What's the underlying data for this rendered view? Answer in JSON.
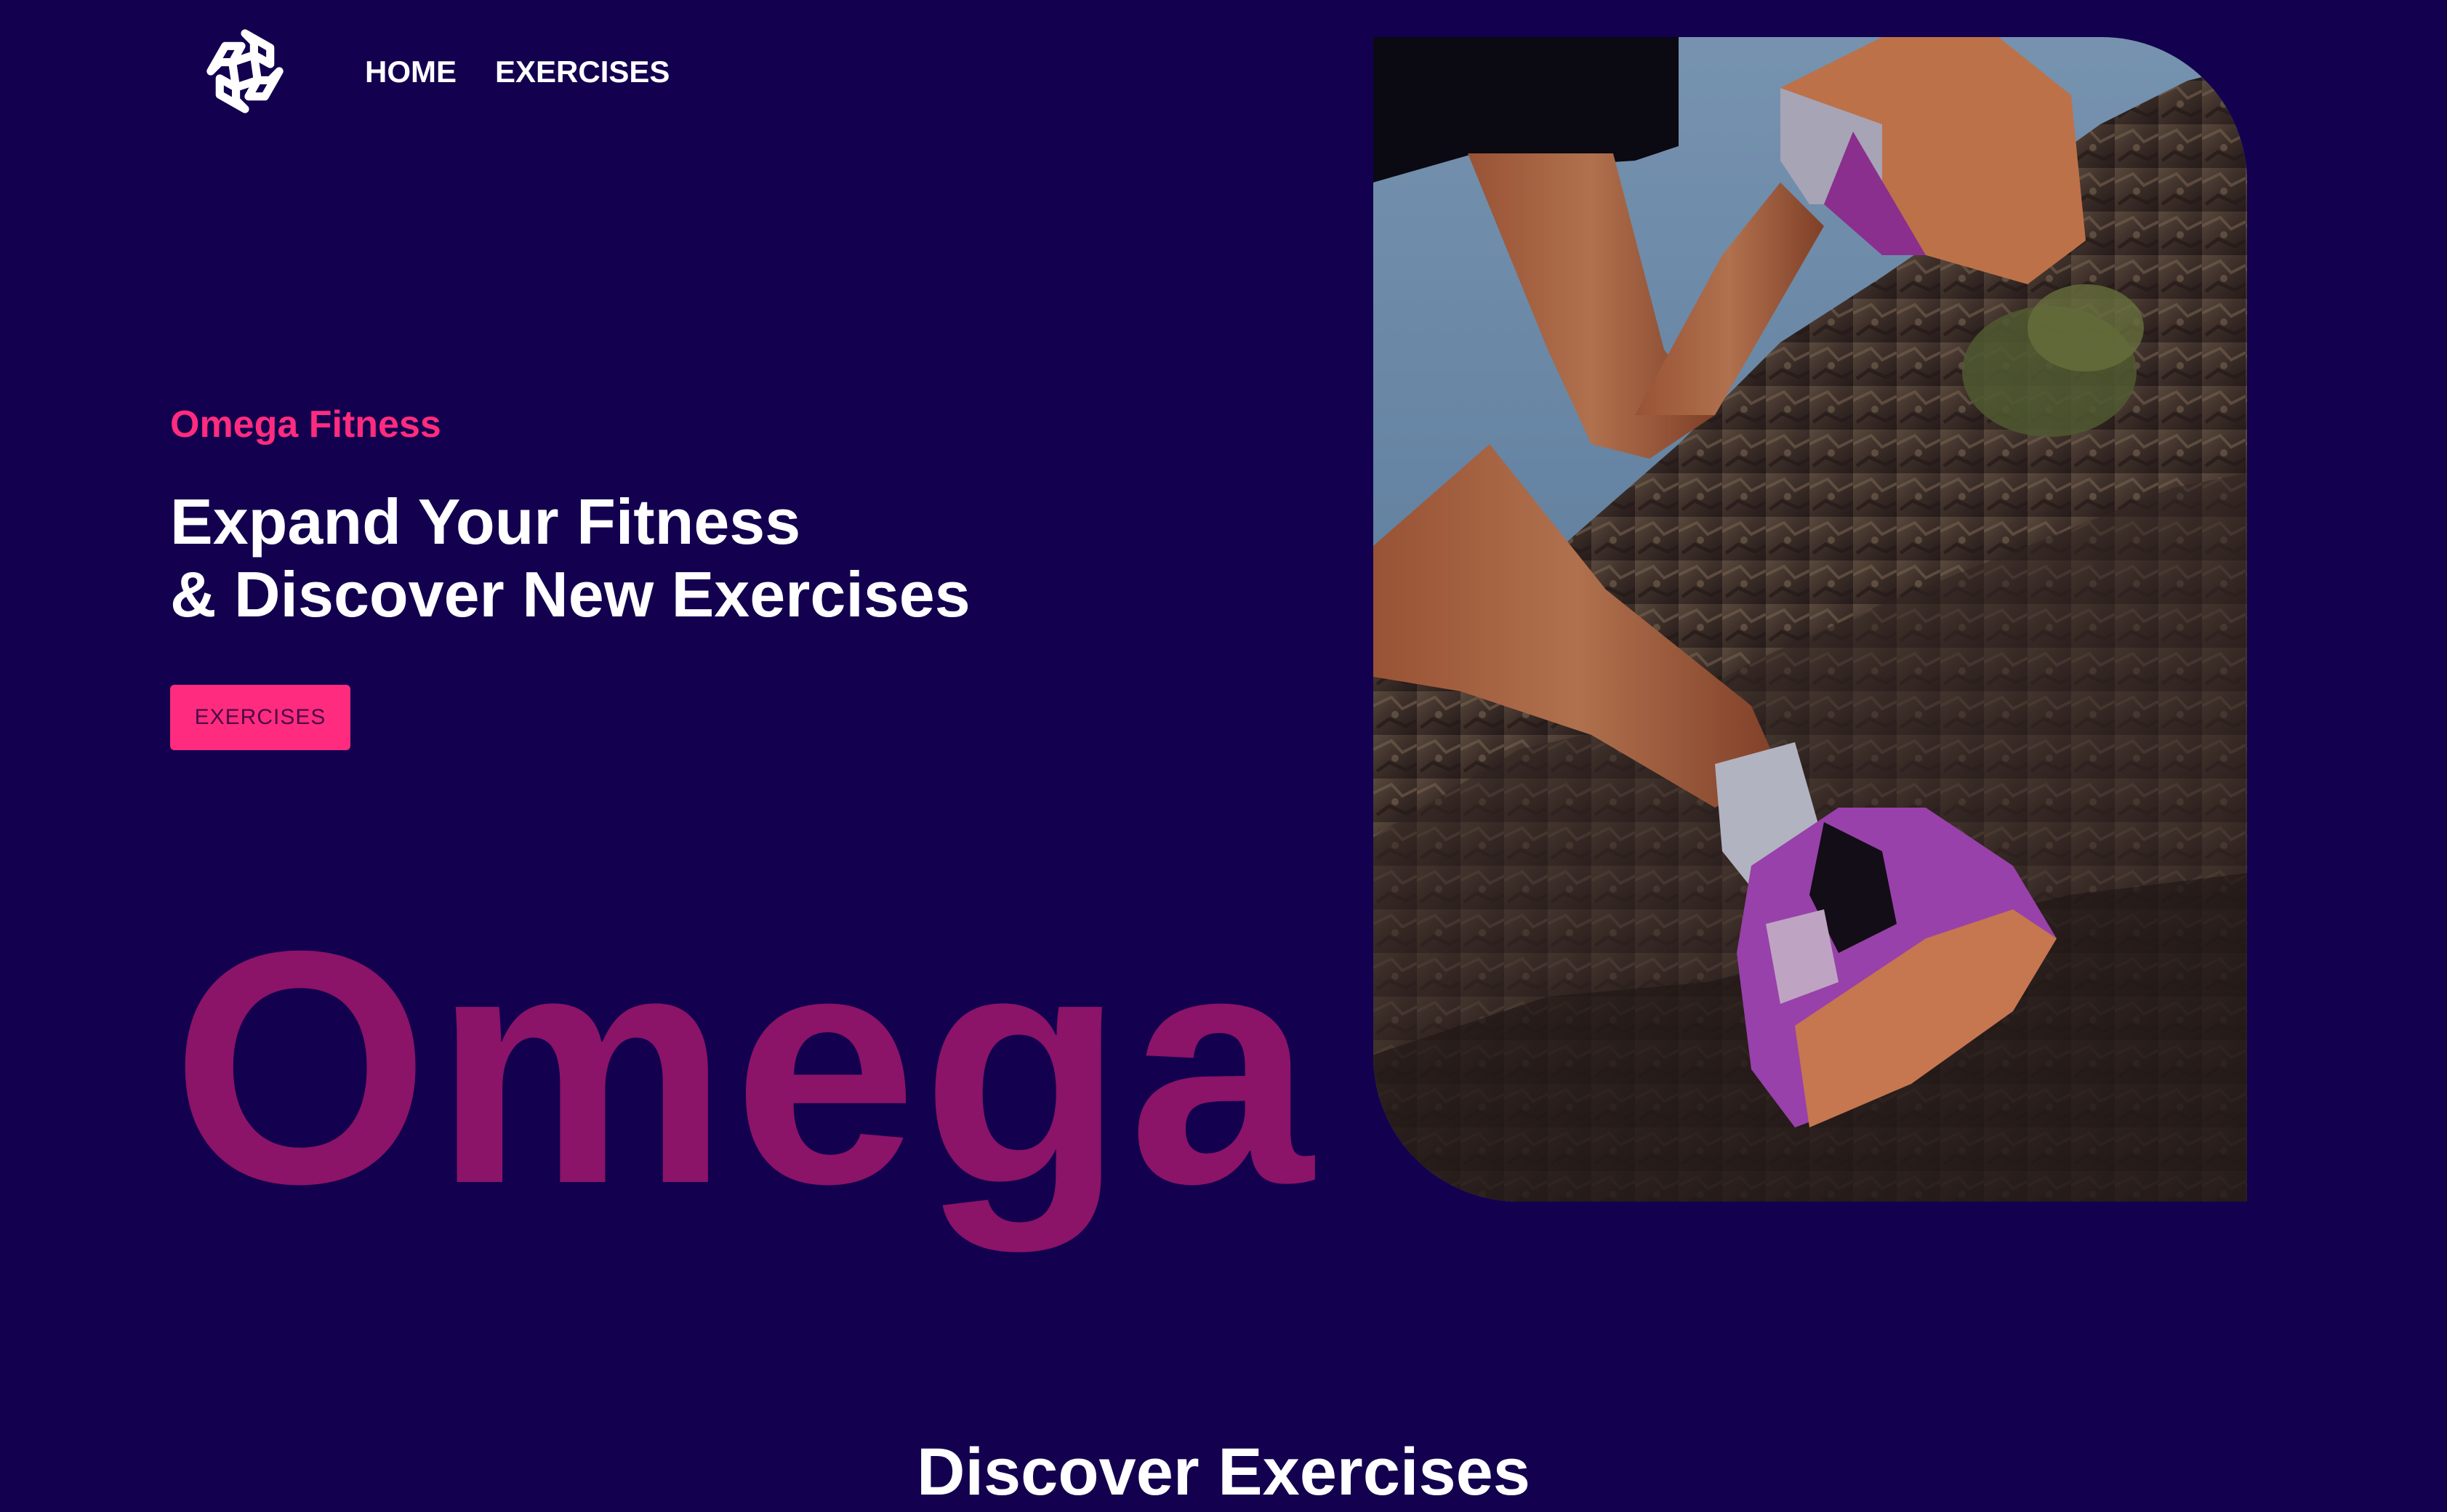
{
  "nav": {
    "logo_icon": "omega-knot-logo-icon",
    "links": [
      {
        "label": "HOME"
      },
      {
        "label": "EXERCISES"
      }
    ]
  },
  "hero": {
    "kicker": "Omega Fitness",
    "title_line_1": "Expand Your Fitness",
    "title_line_2": "& Discover New Exercises",
    "button_label": "EXERCISES",
    "wordmark": "Omega",
    "photo_icon": "trail-runner-photo"
  },
  "sections": {
    "discover_heading": "Discover Exercises"
  },
  "colors": {
    "background": "#13004f",
    "accent_pink": "#ff2b7f",
    "wordmark_magenta": "#8b1368",
    "text_white": "#ffffff"
  }
}
